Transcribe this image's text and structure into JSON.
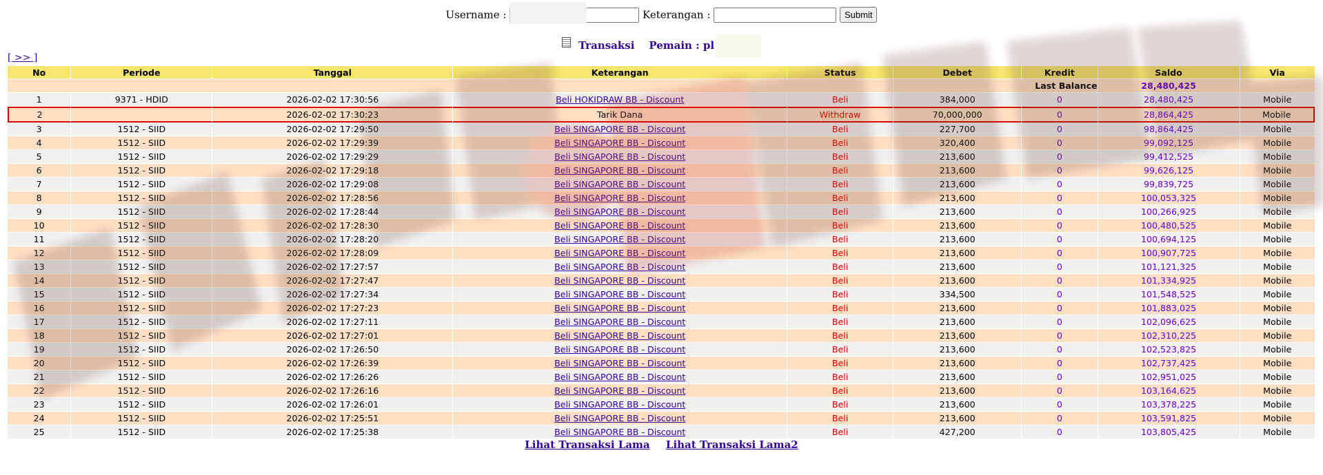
{
  "form": {
    "username_label": "Username :",
    "username_value": "",
    "keterangan_label": "Keterangan :",
    "keterangan_value": "",
    "submit_label": "Submit"
  },
  "heading": {
    "title": "Transaksi",
    "pemain_label": "Pemain : pl"
  },
  "nav_link": "[ >> ]",
  "columns": [
    "No",
    "Periode",
    "Tanggal",
    "Keterangan",
    "Status",
    "Debet",
    "Kredit",
    "Saldo",
    "Via"
  ],
  "last_balance": {
    "label": "Last Balance",
    "value": "28,480,425"
  },
  "rows": [
    {
      "no": "1",
      "periode": "9371 - HDID",
      "tanggal": "2026-02-02 17:30:56",
      "ket": "Beli HOKIDRAW BB - Discount",
      "status": "Beli",
      "debet": "384,000",
      "kredit": "0",
      "saldo": "28,480,425",
      "via": "Mobile"
    },
    {
      "no": "2",
      "periode": "",
      "tanggal": "2026-02-02 17:30:23",
      "ket": "Tarik Dana",
      "status": "Withdraw",
      "debet": "70,000,000",
      "kredit": "0",
      "saldo": "28,864,425",
      "via": "Mobile"
    },
    {
      "no": "3",
      "periode": "1512 - SIID",
      "tanggal": "2026-02-02 17:29:50",
      "ket": "Beli SINGAPORE BB - Discount",
      "status": "Beli",
      "debet": "227,700",
      "kredit": "0",
      "saldo": "98,864,425",
      "via": "Mobile"
    },
    {
      "no": "4",
      "periode": "1512 - SIID",
      "tanggal": "2026-02-02 17:29:39",
      "ket": "Beli SINGAPORE BB - Discount",
      "status": "Beli",
      "debet": "320,400",
      "kredit": "0",
      "saldo": "99,092,125",
      "via": "Mobile"
    },
    {
      "no": "5",
      "periode": "1512 - SIID",
      "tanggal": "2026-02-02 17:29:29",
      "ket": "Beli SINGAPORE BB - Discount",
      "status": "Beli",
      "debet": "213,600",
      "kredit": "0",
      "saldo": "99,412,525",
      "via": "Mobile"
    },
    {
      "no": "6",
      "periode": "1512 - SIID",
      "tanggal": "2026-02-02 17:29:18",
      "ket": "Beli SINGAPORE BB - Discount",
      "status": "Beli",
      "debet": "213,600",
      "kredit": "0",
      "saldo": "99,626,125",
      "via": "Mobile"
    },
    {
      "no": "7",
      "periode": "1512 - SIID",
      "tanggal": "2026-02-02 17:29:08",
      "ket": "Beli SINGAPORE BB - Discount",
      "status": "Beli",
      "debet": "213,600",
      "kredit": "0",
      "saldo": "99,839,725",
      "via": "Mobile"
    },
    {
      "no": "8",
      "periode": "1512 - SIID",
      "tanggal": "2026-02-02 17:28:56",
      "ket": "Beli SINGAPORE BB - Discount",
      "status": "Beli",
      "debet": "213,600",
      "kredit": "0",
      "saldo": "100,053,325",
      "via": "Mobile"
    },
    {
      "no": "9",
      "periode": "1512 - SIID",
      "tanggal": "2026-02-02 17:28:44",
      "ket": "Beli SINGAPORE BB - Discount",
      "status": "Beli",
      "debet": "213,600",
      "kredit": "0",
      "saldo": "100,266,925",
      "via": "Mobile"
    },
    {
      "no": "10",
      "periode": "1512 - SIID",
      "tanggal": "2026-02-02 17:28:30",
      "ket": "Beli SINGAPORE BB - Discount",
      "status": "Beli",
      "debet": "213,600",
      "kredit": "0",
      "saldo": "100,480,525",
      "via": "Mobile"
    },
    {
      "no": "11",
      "periode": "1512 - SIID",
      "tanggal": "2026-02-02 17:28:20",
      "ket": "Beli SINGAPORE BB - Discount",
      "status": "Beli",
      "debet": "213,600",
      "kredit": "0",
      "saldo": "100,694,125",
      "via": "Mobile"
    },
    {
      "no": "12",
      "periode": "1512 - SIID",
      "tanggal": "2026-02-02 17:28:09",
      "ket": "Beli SINGAPORE BB - Discount",
      "status": "Beli",
      "debet": "213,600",
      "kredit": "0",
      "saldo": "100,907,725",
      "via": "Mobile"
    },
    {
      "no": "13",
      "periode": "1512 - SIID",
      "tanggal": "2026-02-02 17:27:57",
      "ket": "Beli SINGAPORE BB - Discount",
      "status": "Beli",
      "debet": "213,600",
      "kredit": "0",
      "saldo": "101,121,325",
      "via": "Mobile"
    },
    {
      "no": "14",
      "periode": "1512 - SIID",
      "tanggal": "2026-02-02 17:27:47",
      "ket": "Beli SINGAPORE BB - Discount",
      "status": "Beli",
      "debet": "213,600",
      "kredit": "0",
      "saldo": "101,334,925",
      "via": "Mobile"
    },
    {
      "no": "15",
      "periode": "1512 - SIID",
      "tanggal": "2026-02-02 17:27:34",
      "ket": "Beli SINGAPORE BB - Discount",
      "status": "Beli",
      "debet": "334,500",
      "kredit": "0",
      "saldo": "101,548,525",
      "via": "Mobile"
    },
    {
      "no": "16",
      "periode": "1512 - SIID",
      "tanggal": "2026-02-02 17:27:23",
      "ket": "Beli SINGAPORE BB - Discount",
      "status": "Beli",
      "debet": "213,600",
      "kredit": "0",
      "saldo": "101,883,025",
      "via": "Mobile"
    },
    {
      "no": "17",
      "periode": "1512 - SIID",
      "tanggal": "2026-02-02 17:27:11",
      "ket": "Beli SINGAPORE BB - Discount",
      "status": "Beli",
      "debet": "213,600",
      "kredit": "0",
      "saldo": "102,096,625",
      "via": "Mobile"
    },
    {
      "no": "18",
      "periode": "1512 - SIID",
      "tanggal": "2026-02-02 17:27:01",
      "ket": "Beli SINGAPORE BB - Discount",
      "status": "Beli",
      "debet": "213,600",
      "kredit": "0",
      "saldo": "102,310,225",
      "via": "Mobile"
    },
    {
      "no": "19",
      "periode": "1512 - SIID",
      "tanggal": "2026-02-02 17:26:50",
      "ket": "Beli SINGAPORE BB - Discount",
      "status": "Beli",
      "debet": "213,600",
      "kredit": "0",
      "saldo": "102,523,825",
      "via": "Mobile"
    },
    {
      "no": "20",
      "periode": "1512 - SIID",
      "tanggal": "2026-02-02 17:26:39",
      "ket": "Beli SINGAPORE BB - Discount",
      "status": "Beli",
      "debet": "213,600",
      "kredit": "0",
      "saldo": "102,737,425",
      "via": "Mobile"
    },
    {
      "no": "21",
      "periode": "1512 - SIID",
      "tanggal": "2026-02-02 17:26:26",
      "ket": "Beli SINGAPORE BB - Discount",
      "status": "Beli",
      "debet": "213,600",
      "kredit": "0",
      "saldo": "102,951,025",
      "via": "Mobile"
    },
    {
      "no": "22",
      "periode": "1512 - SIID",
      "tanggal": "2026-02-02 17:26:16",
      "ket": "Beli SINGAPORE BB - Discount",
      "status": "Beli",
      "debet": "213,600",
      "kredit": "0",
      "saldo": "103,164,625",
      "via": "Mobile"
    },
    {
      "no": "23",
      "periode": "1512 - SIID",
      "tanggal": "2026-02-02 17:26:01",
      "ket": "Beli SINGAPORE BB - Discount",
      "status": "Beli",
      "debet": "213,600",
      "kredit": "0",
      "saldo": "103,378,225",
      "via": "Mobile"
    },
    {
      "no": "24",
      "periode": "1512 - SIID",
      "tanggal": "2026-02-02 17:25:51",
      "ket": "Beli SINGAPORE BB - Discount",
      "status": "Beli",
      "debet": "213,600",
      "kredit": "0",
      "saldo": "103,591,825",
      "via": "Mobile"
    },
    {
      "no": "25",
      "periode": "1512 - SIID",
      "tanggal": "2026-02-02 17:25:38",
      "ket": "Beli SINGAPORE BB - Discount",
      "status": "Beli",
      "debet": "427,200",
      "kredit": "0",
      "saldo": "103,805,425",
      "via": "Mobile"
    }
  ],
  "highlighted_row": "2",
  "bottom_links": [
    "Lihat Transaksi Lama",
    "Lihat Transaksi Lama2"
  ],
  "colors": {
    "header_bg": "#f4e56d",
    "row_odd": "#f0f0f0",
    "row_even": "#fde0c4",
    "link": "#330099",
    "status_red": "#dd0000",
    "saldo_purple": "#6600cc",
    "highlight_border": "#dd0000"
  },
  "icons": [
    "document-icon"
  ]
}
